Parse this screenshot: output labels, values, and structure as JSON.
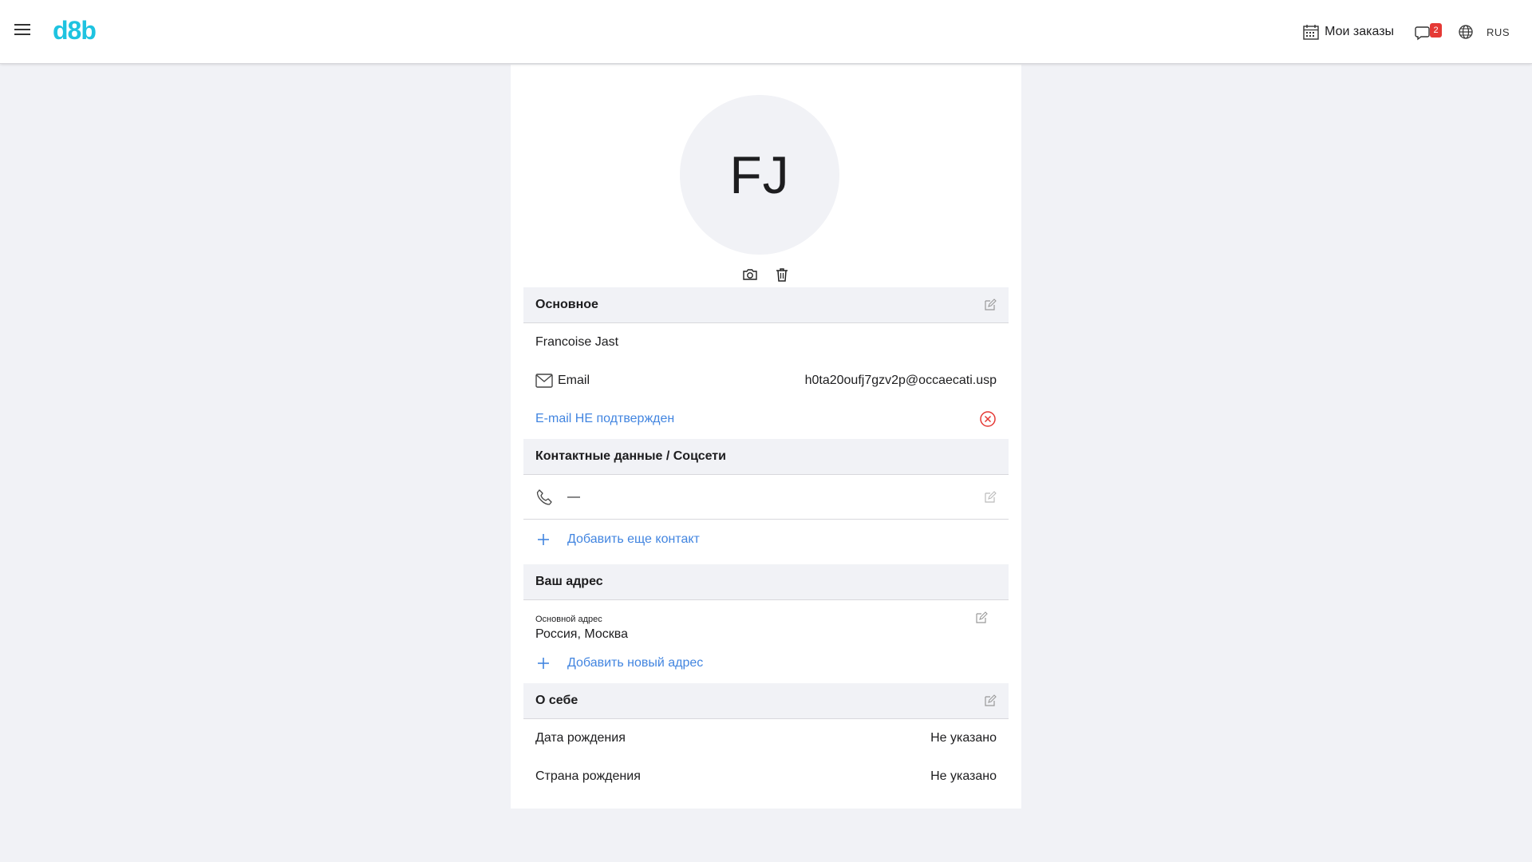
{
  "header": {
    "logo": "d8b",
    "orders_label": "Мои заказы",
    "chat_badge": "2",
    "language": "RUS"
  },
  "profile": {
    "initials": "FJ"
  },
  "basic": {
    "title": "Основное",
    "name": "Francoise Jast",
    "email_label": "Email",
    "email_value": "h0ta20oufj7gzv2p@occaecati.usp",
    "email_status": "E-mail НЕ подтвержден"
  },
  "contacts": {
    "title": "Контактные данные / Соцсети",
    "phone_value": "—",
    "add_label": "Добавить еще контакт"
  },
  "address": {
    "title": "Ваш адрес",
    "main_label": "Основной адрес",
    "main_value": "Россия, Москва",
    "add_label": "Добавить новый адрес"
  },
  "about": {
    "title": "О себе",
    "birth_date_label": "Дата рождения",
    "birth_date_value": "Не указано",
    "birth_country_label": "Страна рождения",
    "birth_country_value": "Не указано"
  },
  "colors": {
    "accent": "#1ec3e0",
    "link": "#4285e0",
    "error": "#e53935",
    "section_bg": "#f1f2f6"
  }
}
